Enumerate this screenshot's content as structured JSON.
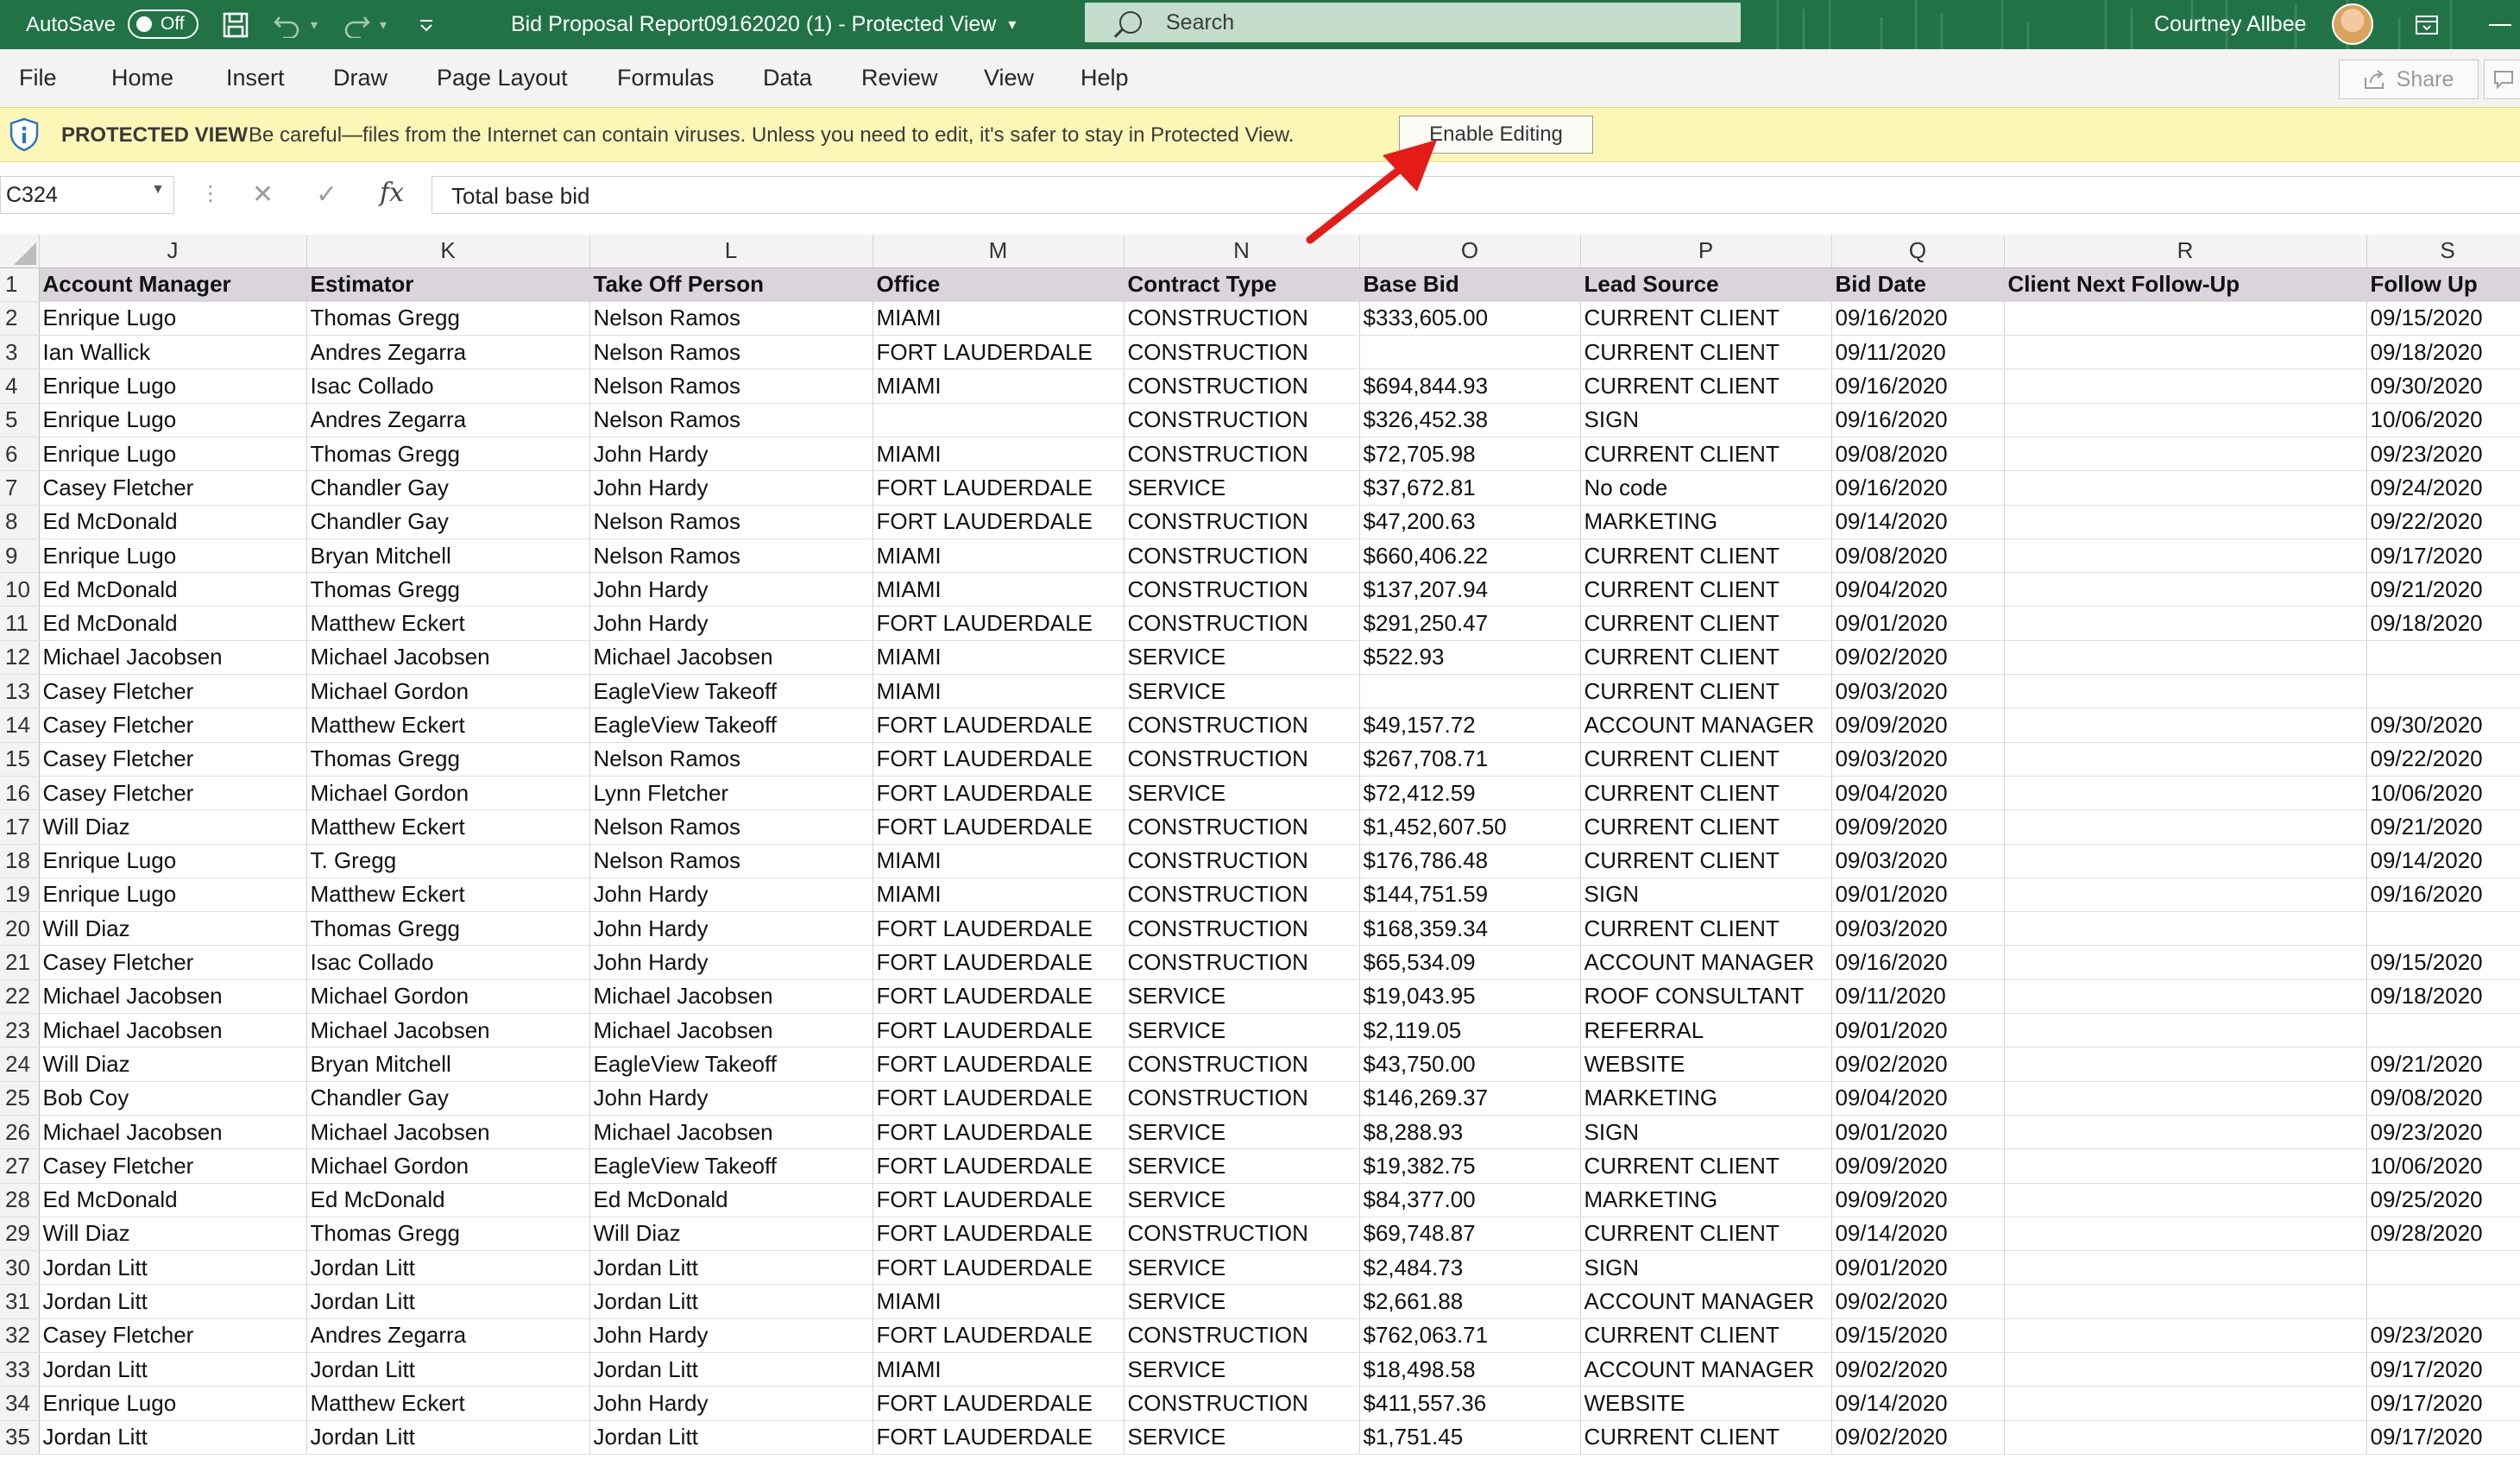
{
  "titlebar": {
    "autosave_label": "AutoSave",
    "autosave_state": "Off",
    "doc_title": "Bid Proposal Report09162020 (1)  -  Protected View",
    "doc_title_caret": "▾",
    "search_placeholder": "Search",
    "user_name": "Courtney  Allbee"
  },
  "ribbon": {
    "tabs": [
      "File",
      "Home",
      "Insert",
      "Draw",
      "Page Layout",
      "Formulas",
      "Data",
      "Review",
      "View",
      "Help"
    ],
    "share_label": "Share"
  },
  "protected_view": {
    "label": "PROTECTED VIEW",
    "message": "Be careful—files from the Internet can contain viruses. Unless you need to edit, it's safer to stay in Protected View.",
    "button_label": "Enable Editing"
  },
  "formula_bar": {
    "name_box": "C324",
    "content": "Total base bid",
    "fx_label": "fx"
  },
  "sheet": {
    "columns": [
      "J",
      "K",
      "L",
      "M",
      "N",
      "O",
      "P",
      "Q",
      "R",
      "S"
    ],
    "headers": [
      "Account Manager",
      "Estimator",
      "Take Off Person",
      "Office",
      "Contract Type",
      "Base Bid",
      "Lead Source",
      "Bid Date",
      "Client Next Follow-Up",
      "Follow Up"
    ],
    "rows": [
      [
        "2",
        "Enrique Lugo",
        "Thomas Gregg",
        "Nelson Ramos",
        "MIAMI",
        "CONSTRUCTION",
        "$333,605.00",
        "CURRENT CLIENT",
        "09/16/2020",
        "",
        "09/15/2020"
      ],
      [
        "3",
        "Ian Wallick",
        "Andres Zegarra",
        "Nelson Ramos",
        "FORT LAUDERDALE",
        "CONSTRUCTION",
        "",
        "CURRENT CLIENT",
        "09/11/2020",
        "",
        "09/18/2020"
      ],
      [
        "4",
        "Enrique Lugo",
        "Isac Collado",
        "Nelson Ramos",
        "MIAMI",
        "CONSTRUCTION",
        "$694,844.93",
        "CURRENT CLIENT",
        "09/16/2020",
        "",
        "09/30/2020"
      ],
      [
        "5",
        "Enrique Lugo",
        "Andres Zegarra",
        "Nelson Ramos",
        "",
        "CONSTRUCTION",
        "$326,452.38",
        "SIGN",
        "09/16/2020",
        "",
        "10/06/2020"
      ],
      [
        "6",
        "Enrique Lugo",
        "Thomas Gregg",
        "John Hardy",
        "MIAMI",
        "CONSTRUCTION",
        "$72,705.98",
        "CURRENT CLIENT",
        "09/08/2020",
        "",
        "09/23/2020"
      ],
      [
        "7",
        "Casey Fletcher",
        "Chandler Gay",
        "John Hardy",
        "FORT LAUDERDALE",
        "SERVICE",
        "$37,672.81",
        "No code",
        "09/16/2020",
        "",
        "09/24/2020"
      ],
      [
        "8",
        "Ed McDonald",
        "Chandler Gay",
        "Nelson Ramos",
        "FORT LAUDERDALE",
        "CONSTRUCTION",
        "$47,200.63",
        "MARKETING",
        "09/14/2020",
        "",
        "09/22/2020"
      ],
      [
        "9",
        "Enrique Lugo",
        "Bryan Mitchell",
        "Nelson Ramos",
        "MIAMI",
        "CONSTRUCTION",
        "$660,406.22",
        "CURRENT CLIENT",
        "09/08/2020",
        "",
        "09/17/2020"
      ],
      [
        "10",
        "Ed McDonald",
        "Thomas Gregg",
        "John Hardy",
        "MIAMI",
        "CONSTRUCTION",
        "$137,207.94",
        "CURRENT CLIENT",
        "09/04/2020",
        "",
        "09/21/2020"
      ],
      [
        "11",
        "Ed McDonald",
        "Matthew Eckert",
        "John Hardy",
        "FORT LAUDERDALE",
        "CONSTRUCTION",
        "$291,250.47",
        "CURRENT CLIENT",
        "09/01/2020",
        "",
        "09/18/2020"
      ],
      [
        "12",
        "Michael Jacobsen",
        "Michael Jacobsen",
        "Michael Jacobsen",
        "MIAMI",
        "SERVICE",
        "$522.93",
        "CURRENT CLIENT",
        "09/02/2020",
        "",
        ""
      ],
      [
        "13",
        "Casey Fletcher",
        "Michael Gordon",
        "EagleView Takeoff",
        "MIAMI",
        "SERVICE",
        "",
        "CURRENT CLIENT",
        "09/03/2020",
        "",
        ""
      ],
      [
        "14",
        "Casey Fletcher",
        "Matthew Eckert",
        "EagleView Takeoff",
        "FORT LAUDERDALE",
        "CONSTRUCTION",
        "$49,157.72",
        "ACCOUNT MANAGER",
        "09/09/2020",
        "",
        "09/30/2020"
      ],
      [
        "15",
        "Casey Fletcher",
        "Thomas Gregg",
        "Nelson Ramos",
        "FORT LAUDERDALE",
        "CONSTRUCTION",
        "$267,708.71",
        "CURRENT CLIENT",
        "09/03/2020",
        "",
        "09/22/2020"
      ],
      [
        "16",
        "Casey Fletcher",
        "Michael Gordon",
        "Lynn Fletcher",
        "FORT LAUDERDALE",
        "SERVICE",
        "$72,412.59",
        "CURRENT CLIENT",
        "09/04/2020",
        "",
        "10/06/2020"
      ],
      [
        "17",
        "Will Diaz",
        "Matthew Eckert",
        "Nelson Ramos",
        "FORT LAUDERDALE",
        "CONSTRUCTION",
        "$1,452,607.50",
        "CURRENT CLIENT",
        "09/09/2020",
        "",
        "09/21/2020"
      ],
      [
        "18",
        "Enrique Lugo",
        "T. Gregg",
        "Nelson Ramos",
        "MIAMI",
        "CONSTRUCTION",
        "$176,786.48",
        "CURRENT CLIENT",
        "09/03/2020",
        "",
        "09/14/2020"
      ],
      [
        "19",
        "Enrique Lugo",
        "Matthew Eckert",
        "John Hardy",
        "MIAMI",
        "CONSTRUCTION",
        "$144,751.59",
        "SIGN",
        "09/01/2020",
        "",
        "09/16/2020"
      ],
      [
        "20",
        "Will Diaz",
        "Thomas Gregg",
        "John Hardy",
        "FORT LAUDERDALE",
        "CONSTRUCTION",
        "$168,359.34",
        "CURRENT CLIENT",
        "09/03/2020",
        "",
        ""
      ],
      [
        "21",
        "Casey Fletcher",
        "Isac Collado",
        "John Hardy",
        "FORT LAUDERDALE",
        "CONSTRUCTION",
        "$65,534.09",
        "ACCOUNT MANAGER",
        "09/16/2020",
        "",
        "09/15/2020"
      ],
      [
        "22",
        "Michael Jacobsen",
        "Michael Gordon",
        "Michael Jacobsen",
        "FORT LAUDERDALE",
        "SERVICE",
        "$19,043.95",
        "ROOF CONSULTANT",
        "09/11/2020",
        "",
        "09/18/2020"
      ],
      [
        "23",
        "Michael Jacobsen",
        "Michael Jacobsen",
        "Michael Jacobsen",
        "FORT LAUDERDALE",
        "SERVICE",
        "$2,119.05",
        "REFERRAL",
        "09/01/2020",
        "",
        ""
      ],
      [
        "24",
        "Will Diaz",
        "Bryan Mitchell",
        "EagleView Takeoff",
        "FORT LAUDERDALE",
        "CONSTRUCTION",
        "$43,750.00",
        "WEBSITE",
        "09/02/2020",
        "",
        "09/21/2020"
      ],
      [
        "25",
        "Bob Coy",
        "Chandler Gay",
        "John Hardy",
        "FORT LAUDERDALE",
        "CONSTRUCTION",
        "$146,269.37",
        "MARKETING",
        "09/04/2020",
        "",
        "09/08/2020"
      ],
      [
        "26",
        "Michael Jacobsen",
        "Michael Jacobsen",
        "Michael Jacobsen",
        "FORT LAUDERDALE",
        "SERVICE",
        "$8,288.93",
        "SIGN",
        "09/01/2020",
        "",
        "09/23/2020"
      ],
      [
        "27",
        "Casey Fletcher",
        "Michael Gordon",
        "EagleView Takeoff",
        "FORT LAUDERDALE",
        "SERVICE",
        "$19,382.75",
        "CURRENT CLIENT",
        "09/09/2020",
        "",
        "10/06/2020"
      ],
      [
        "28",
        "Ed McDonald",
        "Ed McDonald",
        "Ed McDonald",
        "FORT LAUDERDALE",
        "SERVICE",
        "$84,377.00",
        "MARKETING",
        "09/09/2020",
        "",
        "09/25/2020"
      ],
      [
        "29",
        "Will Diaz",
        "Thomas Gregg",
        "Will Diaz",
        "FORT LAUDERDALE",
        "CONSTRUCTION",
        "$69,748.87",
        "CURRENT CLIENT",
        "09/14/2020",
        "",
        "09/28/2020"
      ],
      [
        "30",
        "Jordan Litt",
        "Jordan Litt",
        "Jordan Litt",
        "FORT LAUDERDALE",
        "SERVICE",
        "$2,484.73",
        "SIGN",
        "09/01/2020",
        "",
        ""
      ],
      [
        "31",
        "Jordan Litt",
        "Jordan Litt",
        "Jordan Litt",
        "MIAMI",
        "SERVICE",
        "$2,661.88",
        "ACCOUNT MANAGER",
        "09/02/2020",
        "",
        ""
      ],
      [
        "32",
        "Casey Fletcher",
        "Andres Zegarra",
        "John Hardy",
        "FORT LAUDERDALE",
        "CONSTRUCTION",
        "$762,063.71",
        "CURRENT CLIENT",
        "09/15/2020",
        "",
        "09/23/2020"
      ],
      [
        "33",
        "Jordan Litt",
        "Jordan Litt",
        "Jordan Litt",
        "MIAMI",
        "SERVICE",
        "$18,498.58",
        "ACCOUNT MANAGER",
        "09/02/2020",
        "",
        "09/17/2020"
      ],
      [
        "34",
        "Enrique Lugo",
        "Matthew Eckert",
        "John Hardy",
        "FORT LAUDERDALE",
        "CONSTRUCTION",
        "$411,557.36",
        "WEBSITE",
        "09/14/2020",
        "",
        "09/17/2020"
      ],
      [
        "35",
        "Jordan Litt",
        "Jordan Litt",
        "Jordan Litt",
        "FORT LAUDERDALE",
        "SERVICE",
        "$1,751.45",
        "CURRENT CLIENT",
        "09/02/2020",
        "",
        "09/17/2020"
      ]
    ]
  },
  "colors": {
    "title_bar": "#217346",
    "protected_bar": "#fcf7b6",
    "header_row": "#d9d5db",
    "annotation_arrow": "#e41b17"
  }
}
